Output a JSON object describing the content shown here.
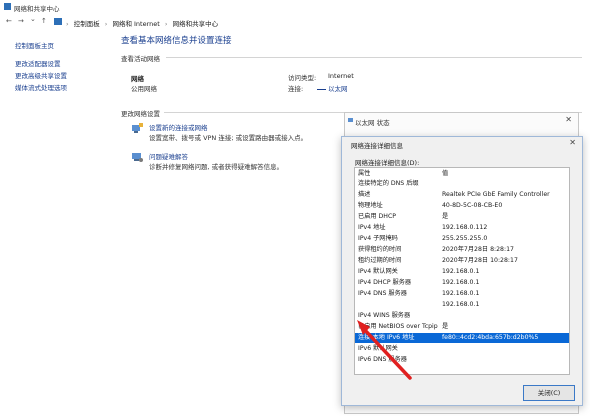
{
  "window": {
    "title": "网络和共享中心"
  },
  "address_bar": {
    "back": "←",
    "forward": "→",
    "history": "⌄",
    "up": "↑",
    "crumbs": [
      "控制面板",
      "网络和 Internet",
      "网络和共享中心"
    ],
    "separator": "›"
  },
  "sidebar": {
    "home": "控制面板主页",
    "links": [
      "更改适配器设置",
      "更改高级共享设置",
      "媒体流式处理选项"
    ]
  },
  "main": {
    "heading": "查看基本网络信息并设置连接",
    "active_section": "查看活动网络",
    "network_name": "网络",
    "network_profile": "公用网络",
    "access_type_label": "访问类型:",
    "access_type_value": "Internet",
    "connections_label": "连接:",
    "connections_value": "以太网",
    "change_section": "更改网络设置",
    "change_items": [
      {
        "title": "设置新的连接或网络",
        "desc": "设置宽带、拨号或 VPN 连接; 或设置路由器或接入点。"
      },
      {
        "title": "问题疑难解答",
        "desc": "诊断并修复网络问题, 或者获得疑难解答信息。"
      }
    ]
  },
  "status_window": {
    "title": "以太网 状态",
    "close": "✕"
  },
  "details_dialog": {
    "title": "网络连接详细信息",
    "close": "✕",
    "list_label": "网络连接详细信息(D):",
    "columns": [
      "属性",
      "值"
    ],
    "rows": [
      [
        "连接特定的 DNS 后缀",
        ""
      ],
      [
        "描述",
        "Realtek PCIe GbE Family Controller"
      ],
      [
        "物理地址",
        "40-8D-5C-08-CB-E0"
      ],
      [
        "已启用 DHCP",
        "是"
      ],
      [
        "IPv4 地址",
        "192.168.0.112"
      ],
      [
        "IPv4 子网掩码",
        "255.255.255.0"
      ],
      [
        "获得租约的时间",
        "2020年7月28日 8:28:17"
      ],
      [
        "租约过期的时间",
        "2020年7月28日 10:28:17"
      ],
      [
        "IPv4 默认网关",
        "192.168.0.1"
      ],
      [
        "IPv4 DHCP 服务器",
        "192.168.0.1"
      ],
      [
        "IPv4 DNS 服务器",
        "192.168.0.1"
      ],
      [
        "",
        "192.168.0.1"
      ],
      [
        "IPv4 WINS 服务器",
        ""
      ],
      [
        "已启用 NetBIOS over Tcpip",
        "是"
      ],
      [
        "连接-本地 IPv6 地址",
        "fe80::4cd2:4bda:657b:d2b0%5"
      ],
      [
        "IPv6 默认网关",
        ""
      ],
      [
        "IPv6 DNS 服务器",
        ""
      ]
    ],
    "selected_row": 14,
    "close_button": "关闭(C)"
  },
  "colors": {
    "link": "#1a3f8f",
    "selection": "#0a68d6",
    "annotation_arrow": "#e02020"
  }
}
